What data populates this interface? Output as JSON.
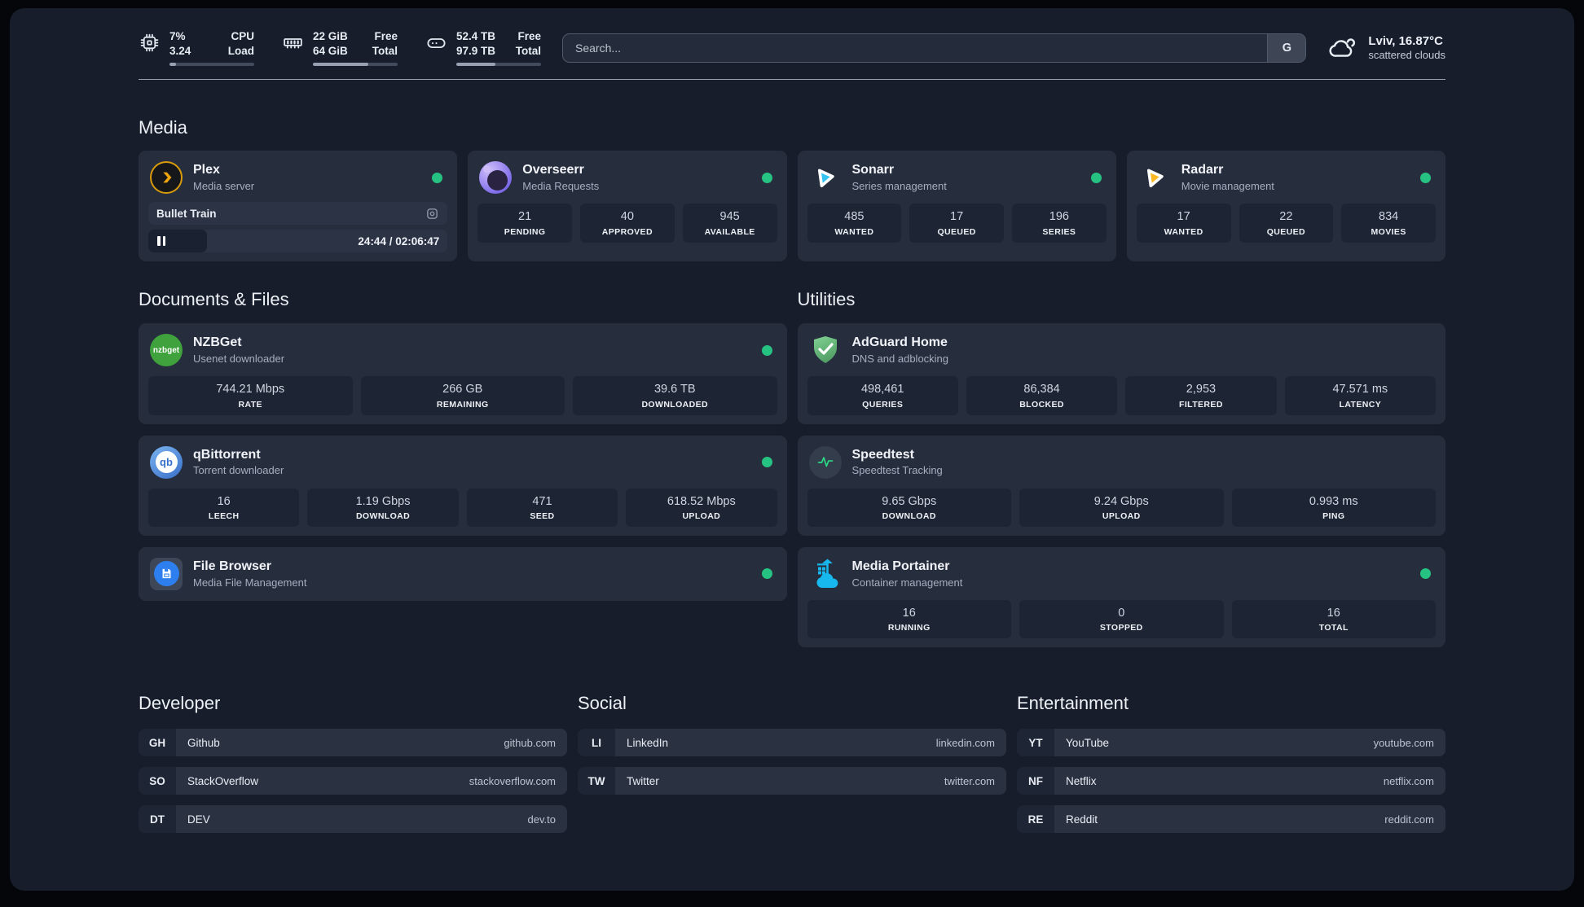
{
  "colors": {
    "status_online": "#26c281",
    "plex_amber": "#e5a00d",
    "sonarr_blue": "#35c3f1",
    "radarr_amber": "#fdb924",
    "nzbget_green": "#3fa23c",
    "qbittorrent_blue": "#3a6fc8",
    "filebrowser_blue": "#2d7ff0",
    "adguard_green": "#67b279",
    "speedtest_green": "#2bd985",
    "portainer_blue": "#17b8ee"
  },
  "topbar": {
    "system_stats": [
      {
        "icon": "cpu-icon",
        "value1": "7%",
        "label1": "CPU",
        "value2": "3.24",
        "label2": "Load",
        "progress_pct": 8
      },
      {
        "icon": "memory-icon",
        "value1": "22 GiB",
        "label1": "Free",
        "value2": "64 GiB",
        "label2": "Total",
        "progress_pct": 65
      },
      {
        "icon": "disk-icon",
        "value1": "52.4 TB",
        "label1": "Free",
        "value2": "97.9 TB",
        "label2": "Total",
        "progress_pct": 46
      }
    ],
    "search": {
      "placeholder": "Search...",
      "provider_button": "G"
    },
    "weather": {
      "icon": "cloud-icon",
      "line1": "Lviv, 16.87°C",
      "line2": "scattered clouds"
    }
  },
  "icons": {
    "nzbget_label": "nzbget",
    "qbittorrent_label": "qb"
  },
  "sections": {
    "media": {
      "title": "Media",
      "cards": [
        {
          "icon": "plex-icon",
          "name": "Plex",
          "description": "Media server",
          "status": "online",
          "now_playing": {
            "title": "Bullet Train",
            "time_display": "24:44 / 02:06:47",
            "progress_pct": 19.5
          }
        },
        {
          "icon": "overseerr-icon",
          "name": "Overseerr",
          "description": "Media Requests",
          "status": "online",
          "stats": [
            {
              "value": "21",
              "label": "PENDING"
            },
            {
              "value": "40",
              "label": "APPROVED"
            },
            {
              "value": "945",
              "label": "AVAILABLE"
            }
          ]
        },
        {
          "icon": "sonarr-icon",
          "name": "Sonarr",
          "description": "Series management",
          "status": "online",
          "stats": [
            {
              "value": "485",
              "label": "WANTED"
            },
            {
              "value": "17",
              "label": "QUEUED"
            },
            {
              "value": "196",
              "label": "SERIES"
            }
          ]
        },
        {
          "icon": "radarr-icon",
          "name": "Radarr",
          "description": "Movie management",
          "status": "online",
          "stats": [
            {
              "value": "17",
              "label": "WANTED"
            },
            {
              "value": "22",
              "label": "QUEUED"
            },
            {
              "value": "834",
              "label": "MOVIES"
            }
          ]
        }
      ]
    },
    "documents": {
      "title": "Documents & Files",
      "cards": [
        {
          "icon": "nzbget-icon",
          "name": "NZBGet",
          "description": "Usenet downloader",
          "status": "online",
          "stats": [
            {
              "value": "744.21 Mbps",
              "label": "RATE"
            },
            {
              "value": "266 GB",
              "label": "REMAINING"
            },
            {
              "value": "39.6 TB",
              "label": "DOWNLOADED"
            }
          ]
        },
        {
          "icon": "qbittorrent-icon",
          "name": "qBittorrent",
          "description": "Torrent downloader",
          "status": "online",
          "stats": [
            {
              "value": "16",
              "label": "LEECH"
            },
            {
              "value": "1.19 Gbps",
              "label": "DOWNLOAD"
            },
            {
              "value": "471",
              "label": "SEED"
            },
            {
              "value": "618.52 Mbps",
              "label": "UPLOAD"
            }
          ]
        },
        {
          "icon": "filebrowser-icon",
          "name": "File Browser",
          "description": "Media File Management",
          "status": "online"
        }
      ]
    },
    "utilities": {
      "title": "Utilities",
      "cards": [
        {
          "icon": "adguard-icon",
          "name": "AdGuard Home",
          "description": "DNS and adblocking",
          "stats": [
            {
              "value": "498,461",
              "label": "QUERIES"
            },
            {
              "value": "86,384",
              "label": "BLOCKED"
            },
            {
              "value": "2,953",
              "label": "FILTERED"
            },
            {
              "value": "47.571 ms",
              "label": "LATENCY"
            }
          ]
        },
        {
          "icon": "speedtest-icon",
          "name": "Speedtest",
          "description": "Speedtest Tracking",
          "stats": [
            {
              "value": "9.65 Gbps",
              "label": "DOWNLOAD"
            },
            {
              "value": "9.24 Gbps",
              "label": "UPLOAD"
            },
            {
              "value": "0.993 ms",
              "label": "PING"
            }
          ]
        },
        {
          "icon": "portainer-icon",
          "name": "Media Portainer",
          "description": "Container management",
          "status": "online",
          "stats": [
            {
              "value": "16",
              "label": "RUNNING"
            },
            {
              "value": "0",
              "label": "STOPPED"
            },
            {
              "value": "16",
              "label": "TOTAL"
            }
          ]
        }
      ]
    }
  },
  "bookmarks": [
    {
      "title": "Developer",
      "items": [
        {
          "abbr": "GH",
          "name": "Github",
          "url": "github.com"
        },
        {
          "abbr": "SO",
          "name": "StackOverflow",
          "url": "stackoverflow.com"
        },
        {
          "abbr": "DT",
          "name": "DEV",
          "url": "dev.to"
        }
      ]
    },
    {
      "title": "Social",
      "items": [
        {
          "abbr": "LI",
          "name": "LinkedIn",
          "url": "linkedin.com"
        },
        {
          "abbr": "TW",
          "name": "Twitter",
          "url": "twitter.com"
        }
      ]
    },
    {
      "title": "Entertainment",
      "items": [
        {
          "abbr": "YT",
          "name": "YouTube",
          "url": "youtube.com"
        },
        {
          "abbr": "NF",
          "name": "Netflix",
          "url": "netflix.com"
        },
        {
          "abbr": "RE",
          "name": "Reddit",
          "url": "reddit.com"
        }
      ]
    }
  ]
}
